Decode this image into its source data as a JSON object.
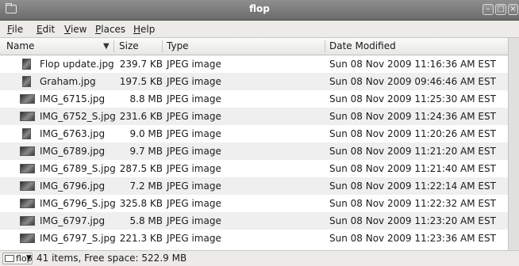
{
  "window": {
    "title": "flop"
  },
  "menu": [
    "File",
    "Edit",
    "View",
    "Places",
    "Help"
  ],
  "menu_mnemonics": [
    "F",
    "E",
    "V",
    "P",
    "H"
  ],
  "columns": {
    "name": "Name",
    "size": "Size",
    "type": "Type",
    "date": "Date Modified"
  },
  "files": [
    {
      "name": "Flop update.jpg",
      "size": "239.7 KB",
      "type": "JPEG image",
      "date": "Sun 08 Nov 2009 11:16:36 AM EST",
      "thumb": "portrait"
    },
    {
      "name": "Graham.jpg",
      "size": "197.5 KB",
      "type": "JPEG image",
      "date": "Sun 08 Nov 2009 09:46:46 AM EST",
      "thumb": "portrait"
    },
    {
      "name": "IMG_6715.jpg",
      "size": "8.8 MB",
      "type": "JPEG image",
      "date": "Sun 08 Nov 2009 11:25:30 AM EST",
      "thumb": "landscape"
    },
    {
      "name": "IMG_6752_S.jpg",
      "size": "231.6 KB",
      "type": "JPEG image",
      "date": "Sun 08 Nov 2009 11:24:36 AM EST",
      "thumb": "landscape"
    },
    {
      "name": "IMG_6763.jpg",
      "size": "9.0 MB",
      "type": "JPEG image",
      "date": "Sun 08 Nov 2009 11:20:26 AM EST",
      "thumb": "portrait"
    },
    {
      "name": "IMG_6789.jpg",
      "size": "9.7 MB",
      "type": "JPEG image",
      "date": "Sun 08 Nov 2009 11:21:20 AM EST",
      "thumb": "landscape"
    },
    {
      "name": "IMG_6789_S.jpg",
      "size": "287.5 KB",
      "type": "JPEG image",
      "date": "Sun 08 Nov 2009 11:21:40 AM EST",
      "thumb": "landscape"
    },
    {
      "name": "IMG_6796.jpg",
      "size": "7.2 MB",
      "type": "JPEG image",
      "date": "Sun 08 Nov 2009 11:22:14 AM EST",
      "thumb": "landscape"
    },
    {
      "name": "IMG_6796_S.jpg",
      "size": "325.8 KB",
      "type": "JPEG image",
      "date": "Sun 08 Nov 2009 11:22:32 AM EST",
      "thumb": "landscape"
    },
    {
      "name": "IMG_6797.jpg",
      "size": "5.8 MB",
      "type": "JPEG image",
      "date": "Sun 08 Nov 2009 11:23:20 AM EST",
      "thumb": "landscape"
    },
    {
      "name": "IMG_6797_S.jpg",
      "size": "221.3 KB",
      "type": "JPEG image",
      "date": "Sun 08 Nov 2009 11:23:36 AM EST",
      "thumb": "landscape"
    }
  ],
  "status": {
    "location": "flop",
    "text": "41 items, Free space: 522.9 MB"
  },
  "icons": {
    "window": "folder-icon",
    "sort": "chevron-down-icon",
    "minimize": "minimize-icon",
    "maximize": "maximize-icon",
    "close": "close-icon"
  }
}
